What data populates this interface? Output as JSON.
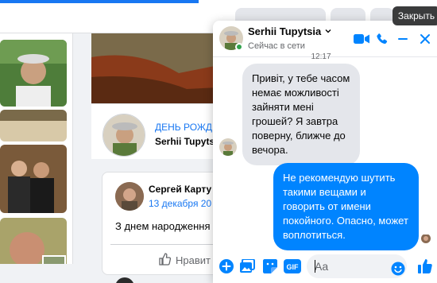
{
  "background": {
    "birthday": {
      "title": "ДЕНЬ РОЖД",
      "name": "Serhii Tupyts"
    },
    "post": {
      "author": "Сергей Карту",
      "date": "13 декабря 20",
      "text": "З днем народження",
      "like_label": "Нравит"
    }
  },
  "chat": {
    "header": {
      "name": "Serhii Tupytsia",
      "status": "Сейчас в сети"
    },
    "timestamp": "12:17",
    "messages": [
      {
        "direction": "incoming",
        "text": "Привіт, у тебе часом немає можливості зайняти мені грошей? Я завтра поверну, ближче до вечора."
      },
      {
        "direction": "outgoing",
        "text": "Не рекомендую шутить такими вещами и говорить от имени покойного. Опасно, может воплотиться."
      }
    ],
    "composer": {
      "placeholder": "Aa"
    },
    "icons": {
      "header": [
        "video-call-icon",
        "phone-call-icon",
        "minimize-icon",
        "close-icon"
      ],
      "composer": [
        "plus-icon",
        "image-icon",
        "sticker-icon",
        "gif-icon",
        "emoji-icon",
        "thumbs-up-icon"
      ]
    },
    "accent_color": "#0084ff",
    "icon_color": "#0084ff"
  },
  "tooltip": {
    "text": "Закрыть"
  },
  "colors": {
    "online": "#31a24c",
    "incoming_bubble": "#e4e6eb",
    "facebook_blue": "#1877f2"
  }
}
